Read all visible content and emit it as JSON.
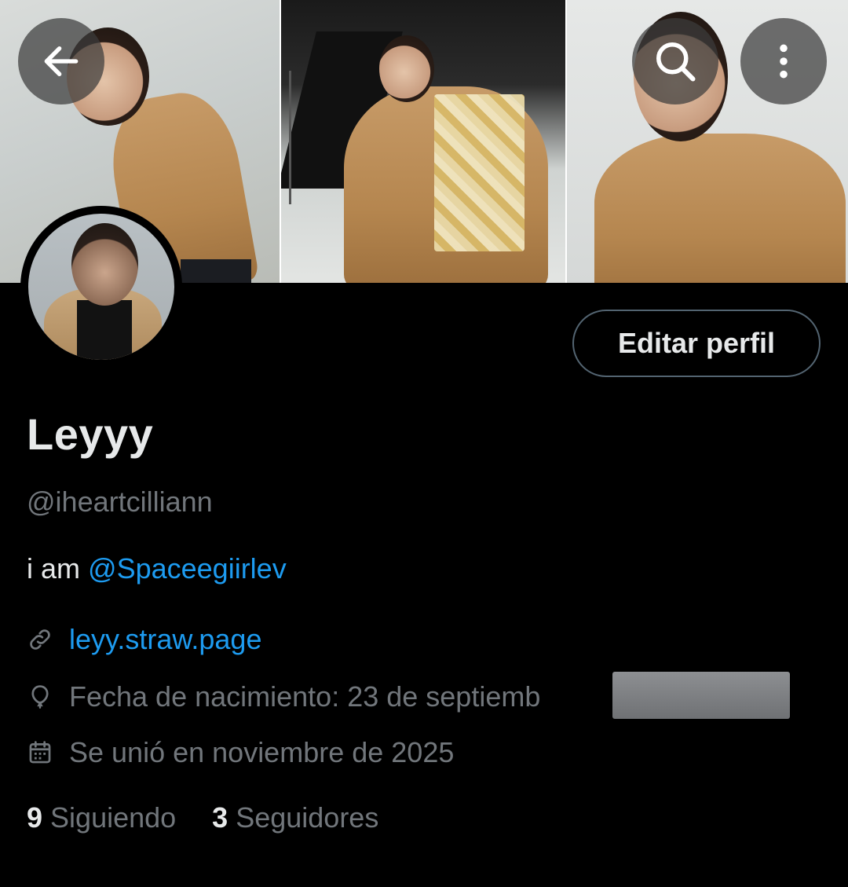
{
  "header": {
    "back_icon": "arrow-left-icon",
    "search_icon": "search-icon",
    "more_icon": "more-vertical-icon"
  },
  "profile": {
    "display_name": "Leyyy",
    "handle": "@iheartcilliann",
    "bio_prefix": "i am",
    "bio_mention": "@Spaceegiirlev",
    "link_icon": "link-icon",
    "link": "leyy.straw.page",
    "birth_icon": "balloon-icon",
    "birthdate": "Fecha de nacimiento: 23 de septiemb",
    "join_icon": "calendar-icon",
    "joined": "Se unió en noviembre de 2025",
    "following_count": "9",
    "following_label": "Siguiendo",
    "followers_count": "3",
    "followers_label": "Seguidores"
  },
  "actions": {
    "edit_profile": "Editar perfil"
  },
  "colors": {
    "background": "#000000",
    "primary_text": "#e7e9ea",
    "secondary_text": "#71767b",
    "accent": "#1d9bf0",
    "button_border": "#536471"
  }
}
